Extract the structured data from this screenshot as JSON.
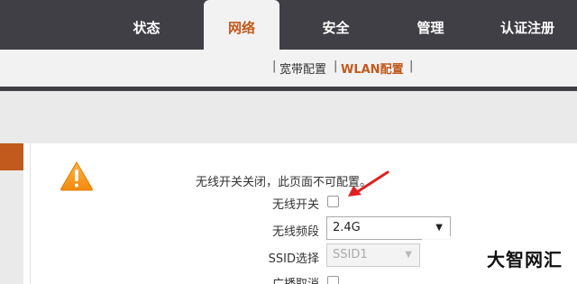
{
  "nav": {
    "tabs": [
      {
        "label": "状态"
      },
      {
        "label": "网络"
      },
      {
        "label": "安全"
      },
      {
        "label": "管理"
      },
      {
        "label": "认证注册"
      }
    ],
    "active_index": 1
  },
  "subnav": {
    "items": [
      {
        "label": "宽带配置"
      },
      {
        "label": "WLAN配置"
      }
    ],
    "separator": "|"
  },
  "content": {
    "notice": "无线开关关闭，此页面不可配置。",
    "fields": {
      "wireless_switch": {
        "label": "无线开关",
        "checked": false
      },
      "band": {
        "label": "无线频段",
        "value": "2.4G"
      },
      "ssid": {
        "label": "SSID选择",
        "value": "SSID1"
      },
      "broadcast_cancel": {
        "label": "广播取消"
      }
    }
  },
  "colors": {
    "accent": "#c15a1c",
    "nav_bg": "#3f3f45",
    "arrow": "#e02020"
  },
  "icons": {
    "warning": "warning-icon",
    "arrow": "red-arrow-annotation"
  },
  "watermark": "大智网汇"
}
